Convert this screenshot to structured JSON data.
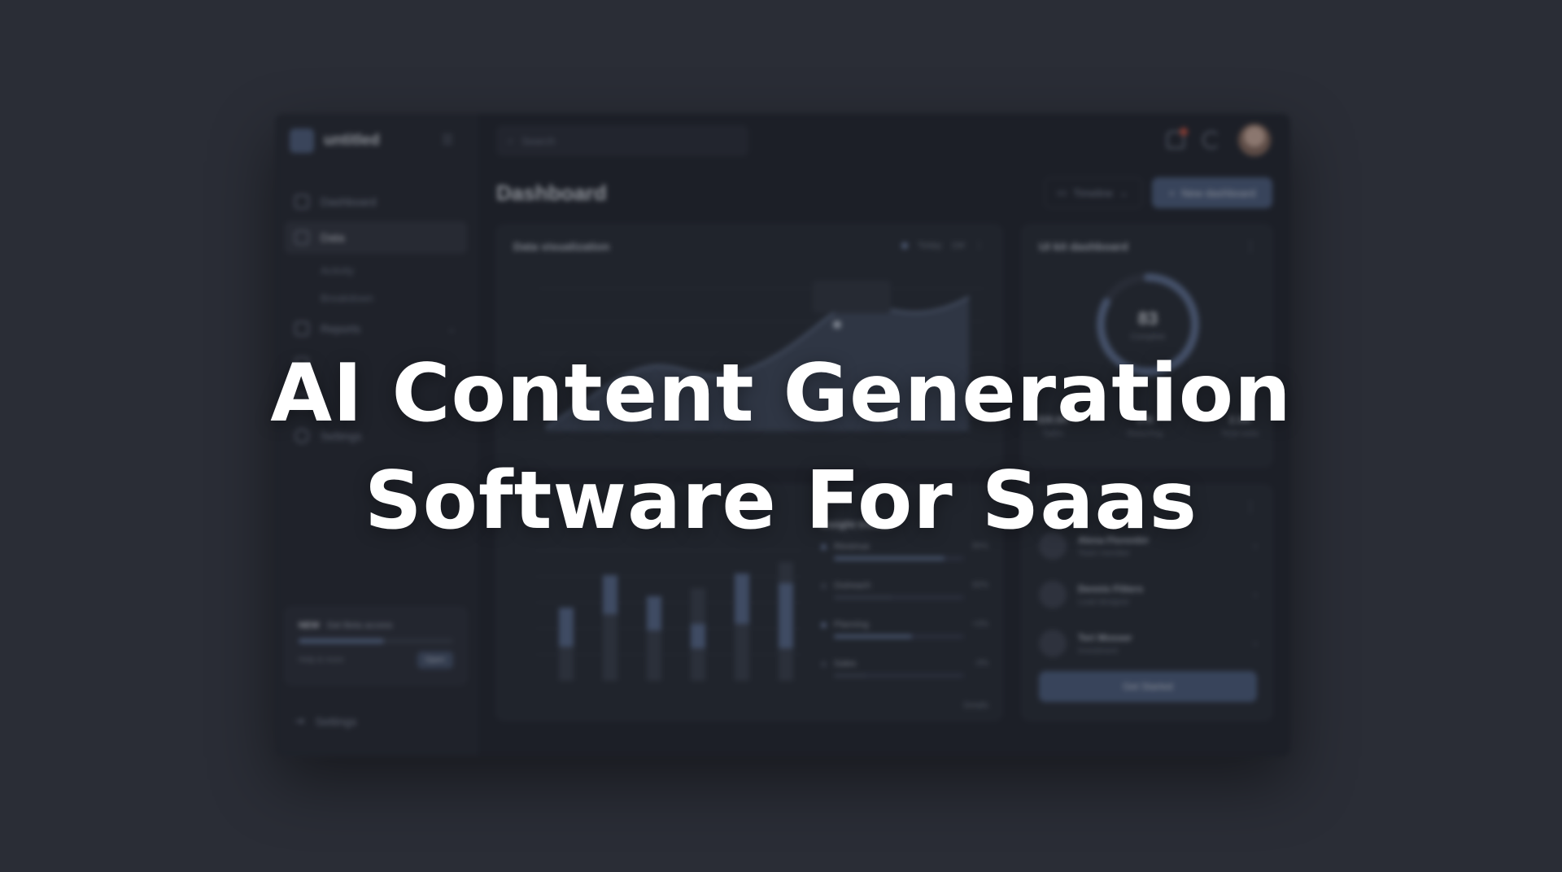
{
  "headline": {
    "line1": "AI Content Generation",
    "line2": "Software For Saas"
  },
  "mockup": {
    "brand": "untitled",
    "search_placeholder": "Search",
    "page_title": "Dashboard",
    "timeline_label": "Timeline",
    "new_button_label": "New dashboard",
    "nav": {
      "dashboard": "Dashboard",
      "data": "Data",
      "sub1": "Activity",
      "sub2": "Breakdown",
      "reports": "Reports",
      "settings": "Settings",
      "footer": "Settings"
    },
    "promo": {
      "badge": "NEW",
      "title": "Get Beta access",
      "foot": "Help & more",
      "button": "Open"
    },
    "viz": {
      "title": "Data visualization",
      "legend1": "Today",
      "legend2": "1W"
    },
    "rate": {
      "title": "UI kit dashboard",
      "value": "83",
      "label": "Complete",
      "stats": [
        {
          "value": "$30.8K",
          "label": "Sales"
        },
        {
          "value": "276",
          "label": "Returning"
        },
        {
          "value": "2.3M",
          "label": "Total visits"
        }
      ]
    },
    "performance": {
      "title": "Insight trends",
      "rows": [
        {
          "name": "Revenue",
          "value": "80%",
          "fill": 0.85
        },
        {
          "name": "Outreach",
          "value": "60%",
          "fill": 0.45
        },
        {
          "name": "Planning",
          "value": "+3%",
          "fill": 0.6
        },
        {
          "name": "Sales",
          "value": "-3%",
          "fill": 0.25
        }
      ],
      "foot": "Details"
    },
    "people": {
      "items": [
        {
          "name": "Alexa Florentin",
          "sub": "Team member"
        },
        {
          "name": "Dennis Fitters",
          "sub": "Lead designer"
        },
        {
          "name": "Teri Mosser",
          "sub": "Investment"
        }
      ],
      "button": "Get Started"
    },
    "colors": {
      "accent": "#5f7397",
      "background": "#2a2d36",
      "notification": "#d2503c"
    }
  }
}
